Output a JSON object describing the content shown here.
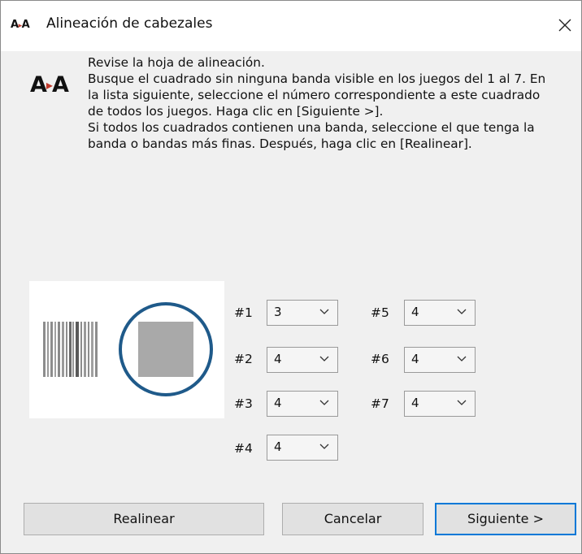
{
  "window": {
    "title": "Alineación de cabezales",
    "icon_text_a1": "A",
    "icon_text_arrow": "▸",
    "icon_text_a2": "A",
    "close_glyph": "✕"
  },
  "logo": {
    "a1": "A",
    "arrow": "▸",
    "a2": "A"
  },
  "instructions": [
    "Revise la hoja de alineación.",
    "Busque el cuadrado sin ninguna banda visible en los juegos del 1 al 7. En",
    "la lista siguiente, seleccione el número correspondiente a este cuadrado",
    "de todos los juegos. Haga clic en [Siguiente >].",
    "Si todos los cuadrados contienen una banda, seleccione el que tenga la",
    "banda o bandas más finas. Después, haga clic en [Realinear]."
  ],
  "sets": [
    {
      "label": "#1",
      "value": "3"
    },
    {
      "label": "#2",
      "value": "4"
    },
    {
      "label": "#3",
      "value": "4"
    },
    {
      "label": "#4",
      "value": "4"
    },
    {
      "label": "#5",
      "value": "4"
    },
    {
      "label": "#6",
      "value": "4"
    },
    {
      "label": "#7",
      "value": "4"
    }
  ],
  "buttons": {
    "realign": "Realinear",
    "cancel": "Cancelar",
    "next": "Siguiente >"
  },
  "colors": {
    "circle": "#1f5a8a",
    "square": "#a9a9a9",
    "primary_border": "#0078d7"
  },
  "icons": {
    "close": "close-icon",
    "dropdown": "chevron-down-icon"
  }
}
